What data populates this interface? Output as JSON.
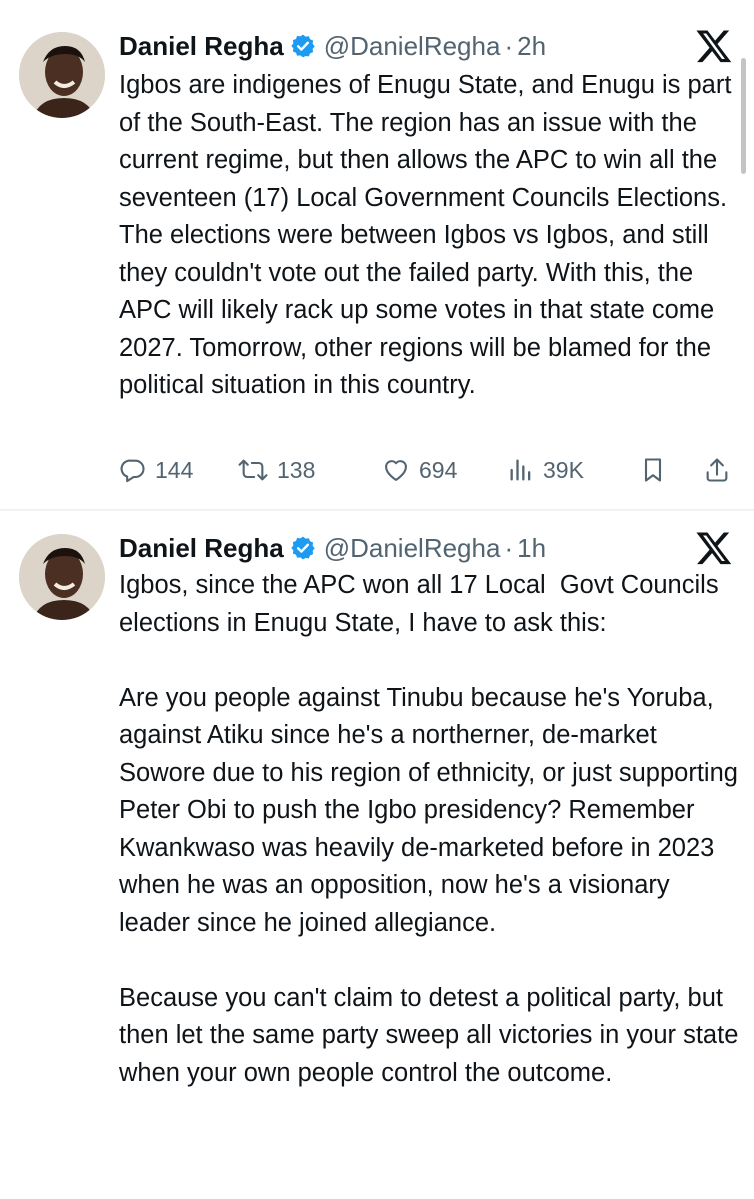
{
  "tweets": [
    {
      "author": {
        "name": "Daniel Regha",
        "handle": "@DanielRegha",
        "verified": true,
        "avatar_icon": "avatar-photo"
      },
      "separator": "·",
      "time": "2h",
      "platform_icon": "x-logo-icon",
      "text": "Igbos are indigenes of Enugu State, and Enugu is part of the South-East. The region has an issue with the current regime, but then allows the APC to win all the seventeen (17) Local Government Councils Elections. The elections were between Igbos vs Igbos, and still they couldn't vote out the failed party. With this, the APC will likely rack up some votes in that state come 2027. Tomorrow, other regions will be blamed for the political situation in this country.",
      "stats": {
        "replies": "144",
        "retweets": "138",
        "likes": "694",
        "views": "39K"
      }
    },
    {
      "author": {
        "name": "Daniel Regha",
        "handle": "@DanielRegha",
        "verified": true,
        "avatar_icon": "avatar-photo"
      },
      "separator": "·",
      "time": "1h",
      "platform_icon": "x-logo-icon",
      "text": "Igbos, since the APC won all 17 Local  Govt Councils elections in Enugu State, I have to ask this:\n\nAre you people against Tinubu because he's Yoruba, against Atiku since he's a northerner, de-market Sowore due to his region of ethnicity, or just supporting Peter Obi to push the Igbo presidency? Remember Kwankwaso was heavily de-marketed before in 2023 when he was an opposition, now he's a visionary leader since he joined allegiance.\n\nBecause you can't claim to detest a political party, but then let the same party sweep all victories in your state when your own people control the outcome."
    }
  ],
  "colors": {
    "text": "#0f1419",
    "secondary": "#536471",
    "verified": "#1d9bf0",
    "divider": "#eff3f4"
  }
}
